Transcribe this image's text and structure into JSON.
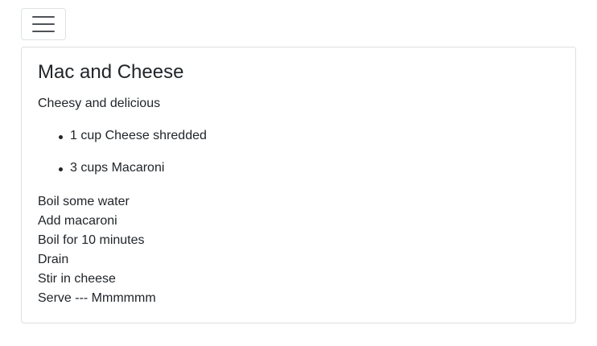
{
  "navbar": {
    "toggler_icon": "hamburger-icon"
  },
  "recipe": {
    "title": "Mac and Cheese",
    "description": "Cheesy and delicious",
    "ingredients": [
      "1 cup Cheese shredded",
      "3 cups Macaroni"
    ],
    "steps": [
      "Boil some water",
      "Add macaroni",
      "Boil for 10 minutes",
      "Drain",
      "Stir in cheese",
      "Serve --- Mmmmmm"
    ]
  }
}
